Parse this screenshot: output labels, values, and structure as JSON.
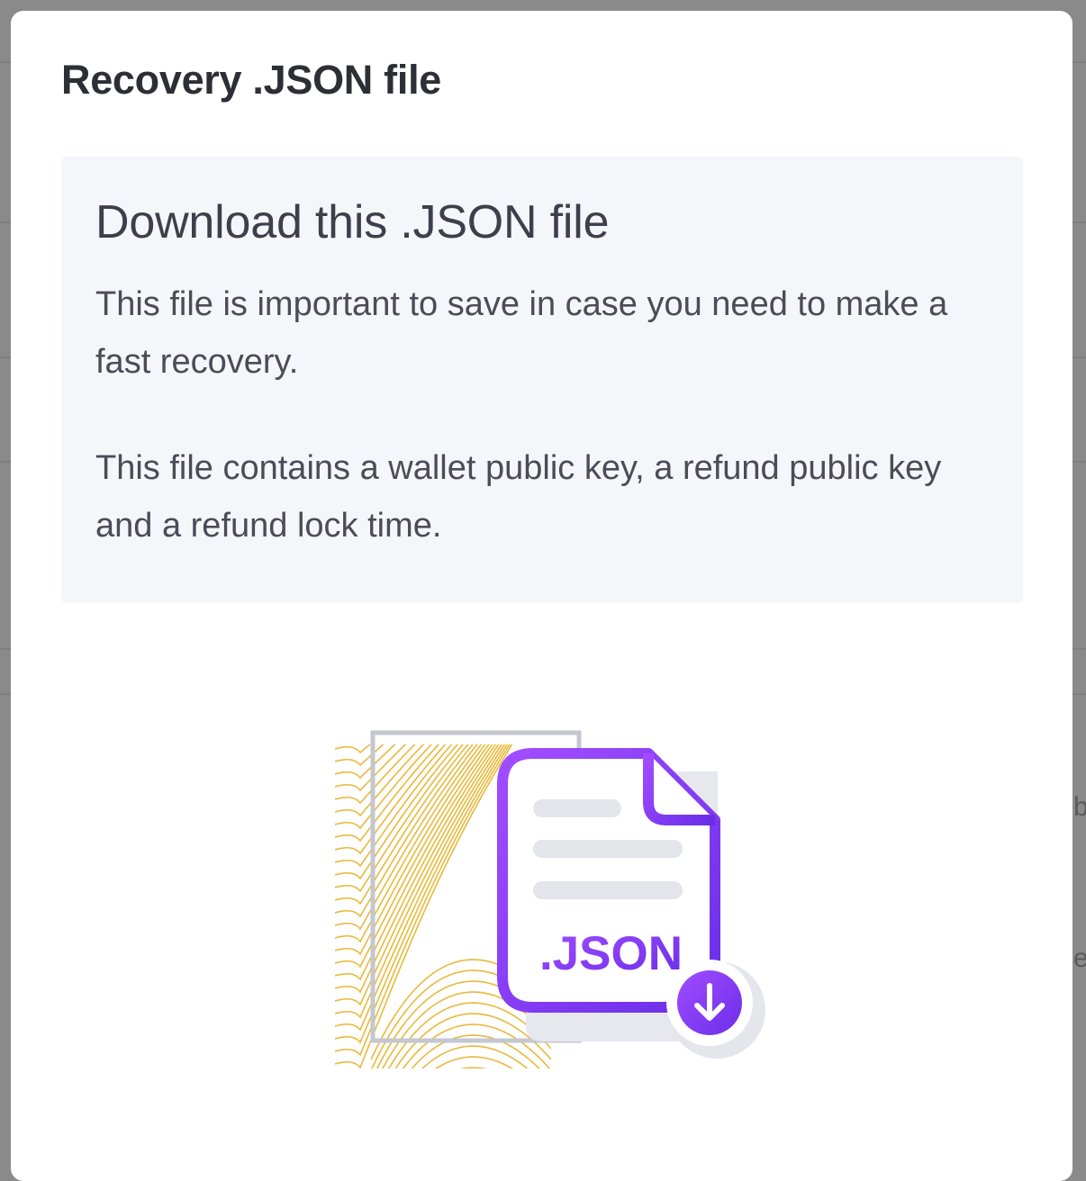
{
  "modal": {
    "title": "Recovery .JSON file",
    "card": {
      "heading": "Download this .JSON file",
      "paragraphs": [
        "This file is important to save in case you need to make a fast recovery.",
        "This file contains a wallet public key, a refund public key and a refund lock time."
      ]
    },
    "illustration": {
      "file_label": ".JSON",
      "icons": [
        "json-file-icon",
        "download-arrow-icon"
      ],
      "colors": {
        "purple_light": "#a24dff",
        "purple_dark": "#6a2ee8",
        "gold": "#e8b93c",
        "gray": "#c4c7cf"
      }
    }
  },
  "background": {
    "edge_glyphs": [
      "b",
      "e"
    ]
  }
}
